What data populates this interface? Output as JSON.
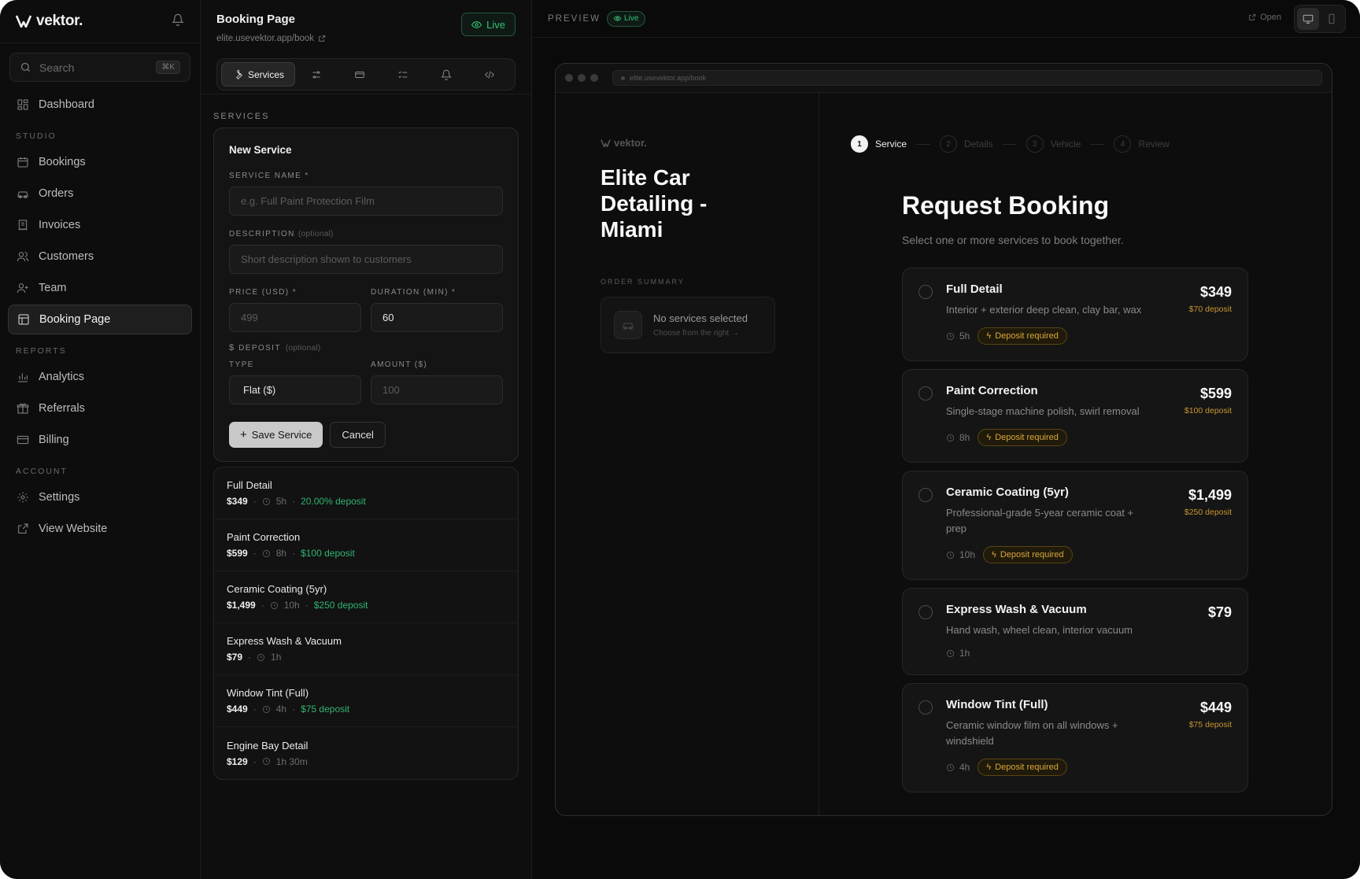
{
  "brand": {
    "name": "vektor."
  },
  "sidebar": {
    "search_placeholder": "Search",
    "search_shortcut": "⌘K",
    "top_items": [
      {
        "label": "Dashboard",
        "icon": "grid-icon"
      }
    ],
    "sections": [
      {
        "title": "STUDIO",
        "items": [
          {
            "label": "Bookings",
            "icon": "calendar-icon"
          },
          {
            "label": "Orders",
            "icon": "car-icon"
          },
          {
            "label": "Invoices",
            "icon": "receipt-icon"
          },
          {
            "label": "Customers",
            "icon": "users-icon"
          },
          {
            "label": "Team",
            "icon": "user-plus-icon"
          },
          {
            "label": "Booking Page",
            "icon": "layout-icon",
            "active": true
          }
        ]
      },
      {
        "title": "REPORTS",
        "items": [
          {
            "label": "Analytics",
            "icon": "bar-chart-icon"
          },
          {
            "label": "Referrals",
            "icon": "gift-icon"
          },
          {
            "label": "Billing",
            "icon": "credit-card-icon"
          }
        ]
      },
      {
        "title": "ACCOUNT",
        "items": [
          {
            "label": "Settings",
            "icon": "gear-icon"
          },
          {
            "label": "View Website",
            "icon": "external-link-icon"
          }
        ]
      }
    ]
  },
  "editor": {
    "title": "Booking Page",
    "url": "elite.usevektor.app/book",
    "live_label": "Live",
    "tabs": [
      {
        "label": "Services",
        "icon": "wrench-icon",
        "active": true
      },
      {
        "label": "",
        "icon": "sliders-icon"
      },
      {
        "label": "",
        "icon": "card-icon"
      },
      {
        "label": "",
        "icon": "checklist-icon"
      },
      {
        "label": "",
        "icon": "bell-icon"
      },
      {
        "label": "",
        "icon": "code-icon"
      }
    ],
    "section_label": "SERVICES",
    "form": {
      "title": "New Service",
      "service_name_label": "SERVICE NAME *",
      "service_name_placeholder": "e.g. Full Paint Protection Film",
      "description_label": "DESCRIPTION",
      "optional": "(optional)",
      "description_placeholder": "Short description shown to customers",
      "price_label": "PRICE (USD) *",
      "price_placeholder": "499",
      "duration_label": "DURATION (MIN) *",
      "duration_value": "60",
      "deposit_label": "DEPOSIT",
      "type_label": "TYPE",
      "type_value": "Flat ($)",
      "amount_label": "AMOUNT ($)",
      "amount_placeholder": "100",
      "save_label": "Save Service",
      "cancel_label": "Cancel"
    },
    "services": [
      {
        "name": "Full Detail",
        "price": "$349",
        "duration": "5h",
        "deposit": "20.00% deposit"
      },
      {
        "name": "Paint Correction",
        "price": "$599",
        "duration": "8h",
        "deposit": "$100 deposit"
      },
      {
        "name": "Ceramic Coating (5yr)",
        "price": "$1,499",
        "duration": "10h",
        "deposit": "$250 deposit"
      },
      {
        "name": "Express Wash & Vacuum",
        "price": "$79",
        "duration": "1h",
        "deposit": ""
      },
      {
        "name": "Window Tint (Full)",
        "price": "$449",
        "duration": "4h",
        "deposit": "$75 deposit"
      },
      {
        "name": "Engine Bay Detail",
        "price": "$129",
        "duration": "1h 30m",
        "deposit": ""
      }
    ]
  },
  "preview": {
    "label": "PREVIEW",
    "live_label": "Live",
    "open_label": "Open",
    "browser_url": "elite.usevektor.app/book",
    "mini_logo": "vektor.",
    "business_name": "Elite Car Detailing - Miami",
    "order_summary_label": "ORDER SUMMARY",
    "order_empty_title": "No services selected",
    "order_empty_sub": "Choose from the right →",
    "steps": [
      {
        "num": "1",
        "label": "Service",
        "active": true
      },
      {
        "num": "2",
        "label": "Details"
      },
      {
        "num": "3",
        "label": "Vehicle"
      },
      {
        "num": "4",
        "label": "Review"
      }
    ],
    "title": "Request Booking",
    "subtitle": "Select one or more services to book together.",
    "deposit_badge": "Deposit required",
    "cards": [
      {
        "name": "Full Detail",
        "desc": "Interior + exterior deep clean, clay bar, wax",
        "price": "$349",
        "deposit": "$70 deposit",
        "duration": "5h",
        "requires_deposit": true
      },
      {
        "name": "Paint Correction",
        "desc": "Single-stage machine polish, swirl removal",
        "price": "$599",
        "deposit": "$100 deposit",
        "duration": "8h",
        "requires_deposit": true
      },
      {
        "name": "Ceramic Coating (5yr)",
        "desc": "Professional-grade 5-year ceramic coat + prep",
        "price": "$1,499",
        "deposit": "$250 deposit",
        "duration": "10h",
        "requires_deposit": true
      },
      {
        "name": "Express Wash & Vacuum",
        "desc": "Hand wash, wheel clean, interior vacuum",
        "price": "$79",
        "deposit": "",
        "duration": "1h",
        "requires_deposit": false
      },
      {
        "name": "Window Tint (Full)",
        "desc": "Ceramic window film on all windows + windshield",
        "price": "$449",
        "deposit": "$75 deposit",
        "duration": "4h",
        "requires_deposit": true
      }
    ]
  },
  "colors": {
    "accent_green": "#35c27a",
    "deposit_amber": "#d9a73a",
    "background": "#0b0b0b"
  }
}
